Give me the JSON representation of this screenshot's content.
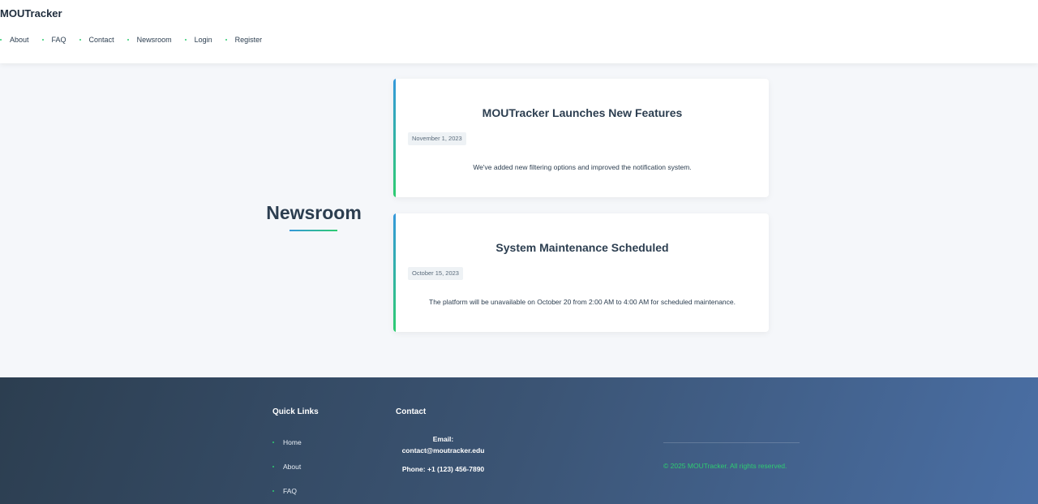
{
  "header": {
    "brand": "MOUTracker",
    "nav": [
      {
        "label": "About"
      },
      {
        "label": "FAQ"
      },
      {
        "label": "Contact"
      },
      {
        "label": "Newsroom"
      },
      {
        "label": "Login"
      },
      {
        "label": "Register"
      }
    ]
  },
  "main": {
    "title": "Newsroom",
    "news": [
      {
        "title": "MOUTracker Launches New Features",
        "date": "November 1, 2023",
        "body": "We've added new filtering options and improved the notification system."
      },
      {
        "title": "System Maintenance Scheduled",
        "date": "October 15, 2023",
        "body": "The platform will be unavailable on October 20 from 2:00 AM to 4:00 AM for scheduled maintenance."
      }
    ]
  },
  "footer": {
    "quick_links_heading": "Quick Links",
    "quick_links": [
      {
        "label": "Home"
      },
      {
        "label": "About"
      },
      {
        "label": "FAQ"
      }
    ],
    "contact_heading": "Contact",
    "email_label": "Email:",
    "email": "contact@moutracker.edu",
    "phone": "Phone: +1 (123) 456-7890",
    "copyright": "© 2025 MOUTracker. All rights reserved."
  },
  "colors": {
    "accent_green": "#2ecc71",
    "accent_blue": "#3498db",
    "text_dark": "#2c3e50",
    "footer_start": "#2c3e50",
    "footer_end": "#4a6fa5"
  }
}
